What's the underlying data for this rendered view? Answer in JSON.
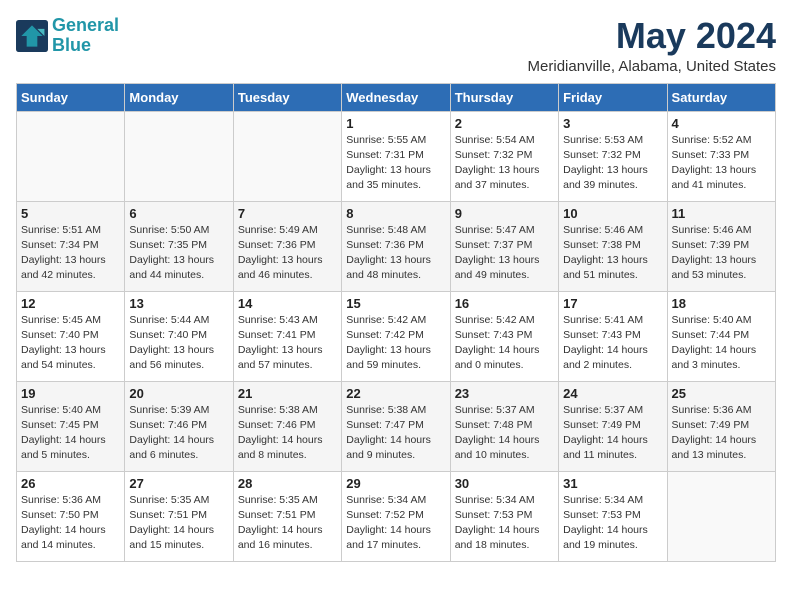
{
  "header": {
    "logo_line1": "General",
    "logo_line2": "Blue",
    "month": "May 2024",
    "location": "Meridianville, Alabama, United States"
  },
  "weekdays": [
    "Sunday",
    "Monday",
    "Tuesday",
    "Wednesday",
    "Thursday",
    "Friday",
    "Saturday"
  ],
  "weeks": [
    [
      {
        "day": "",
        "info": ""
      },
      {
        "day": "",
        "info": ""
      },
      {
        "day": "",
        "info": ""
      },
      {
        "day": "1",
        "info": "Sunrise: 5:55 AM\nSunset: 7:31 PM\nDaylight: 13 hours\nand 35 minutes."
      },
      {
        "day": "2",
        "info": "Sunrise: 5:54 AM\nSunset: 7:32 PM\nDaylight: 13 hours\nand 37 minutes."
      },
      {
        "day": "3",
        "info": "Sunrise: 5:53 AM\nSunset: 7:32 PM\nDaylight: 13 hours\nand 39 minutes."
      },
      {
        "day": "4",
        "info": "Sunrise: 5:52 AM\nSunset: 7:33 PM\nDaylight: 13 hours\nand 41 minutes."
      }
    ],
    [
      {
        "day": "5",
        "info": "Sunrise: 5:51 AM\nSunset: 7:34 PM\nDaylight: 13 hours\nand 42 minutes."
      },
      {
        "day": "6",
        "info": "Sunrise: 5:50 AM\nSunset: 7:35 PM\nDaylight: 13 hours\nand 44 minutes."
      },
      {
        "day": "7",
        "info": "Sunrise: 5:49 AM\nSunset: 7:36 PM\nDaylight: 13 hours\nand 46 minutes."
      },
      {
        "day": "8",
        "info": "Sunrise: 5:48 AM\nSunset: 7:36 PM\nDaylight: 13 hours\nand 48 minutes."
      },
      {
        "day": "9",
        "info": "Sunrise: 5:47 AM\nSunset: 7:37 PM\nDaylight: 13 hours\nand 49 minutes."
      },
      {
        "day": "10",
        "info": "Sunrise: 5:46 AM\nSunset: 7:38 PM\nDaylight: 13 hours\nand 51 minutes."
      },
      {
        "day": "11",
        "info": "Sunrise: 5:46 AM\nSunset: 7:39 PM\nDaylight: 13 hours\nand 53 minutes."
      }
    ],
    [
      {
        "day": "12",
        "info": "Sunrise: 5:45 AM\nSunset: 7:40 PM\nDaylight: 13 hours\nand 54 minutes."
      },
      {
        "day": "13",
        "info": "Sunrise: 5:44 AM\nSunset: 7:40 PM\nDaylight: 13 hours\nand 56 minutes."
      },
      {
        "day": "14",
        "info": "Sunrise: 5:43 AM\nSunset: 7:41 PM\nDaylight: 13 hours\nand 57 minutes."
      },
      {
        "day": "15",
        "info": "Sunrise: 5:42 AM\nSunset: 7:42 PM\nDaylight: 13 hours\nand 59 minutes."
      },
      {
        "day": "16",
        "info": "Sunrise: 5:42 AM\nSunset: 7:43 PM\nDaylight: 14 hours\nand 0 minutes."
      },
      {
        "day": "17",
        "info": "Sunrise: 5:41 AM\nSunset: 7:43 PM\nDaylight: 14 hours\nand 2 minutes."
      },
      {
        "day": "18",
        "info": "Sunrise: 5:40 AM\nSunset: 7:44 PM\nDaylight: 14 hours\nand 3 minutes."
      }
    ],
    [
      {
        "day": "19",
        "info": "Sunrise: 5:40 AM\nSunset: 7:45 PM\nDaylight: 14 hours\nand 5 minutes."
      },
      {
        "day": "20",
        "info": "Sunrise: 5:39 AM\nSunset: 7:46 PM\nDaylight: 14 hours\nand 6 minutes."
      },
      {
        "day": "21",
        "info": "Sunrise: 5:38 AM\nSunset: 7:46 PM\nDaylight: 14 hours\nand 8 minutes."
      },
      {
        "day": "22",
        "info": "Sunrise: 5:38 AM\nSunset: 7:47 PM\nDaylight: 14 hours\nand 9 minutes."
      },
      {
        "day": "23",
        "info": "Sunrise: 5:37 AM\nSunset: 7:48 PM\nDaylight: 14 hours\nand 10 minutes."
      },
      {
        "day": "24",
        "info": "Sunrise: 5:37 AM\nSunset: 7:49 PM\nDaylight: 14 hours\nand 11 minutes."
      },
      {
        "day": "25",
        "info": "Sunrise: 5:36 AM\nSunset: 7:49 PM\nDaylight: 14 hours\nand 13 minutes."
      }
    ],
    [
      {
        "day": "26",
        "info": "Sunrise: 5:36 AM\nSunset: 7:50 PM\nDaylight: 14 hours\nand 14 minutes."
      },
      {
        "day": "27",
        "info": "Sunrise: 5:35 AM\nSunset: 7:51 PM\nDaylight: 14 hours\nand 15 minutes."
      },
      {
        "day": "28",
        "info": "Sunrise: 5:35 AM\nSunset: 7:51 PM\nDaylight: 14 hours\nand 16 minutes."
      },
      {
        "day": "29",
        "info": "Sunrise: 5:34 AM\nSunset: 7:52 PM\nDaylight: 14 hours\nand 17 minutes."
      },
      {
        "day": "30",
        "info": "Sunrise: 5:34 AM\nSunset: 7:53 PM\nDaylight: 14 hours\nand 18 minutes."
      },
      {
        "day": "31",
        "info": "Sunrise: 5:34 AM\nSunset: 7:53 PM\nDaylight: 14 hours\nand 19 minutes."
      },
      {
        "day": "",
        "info": ""
      }
    ]
  ]
}
